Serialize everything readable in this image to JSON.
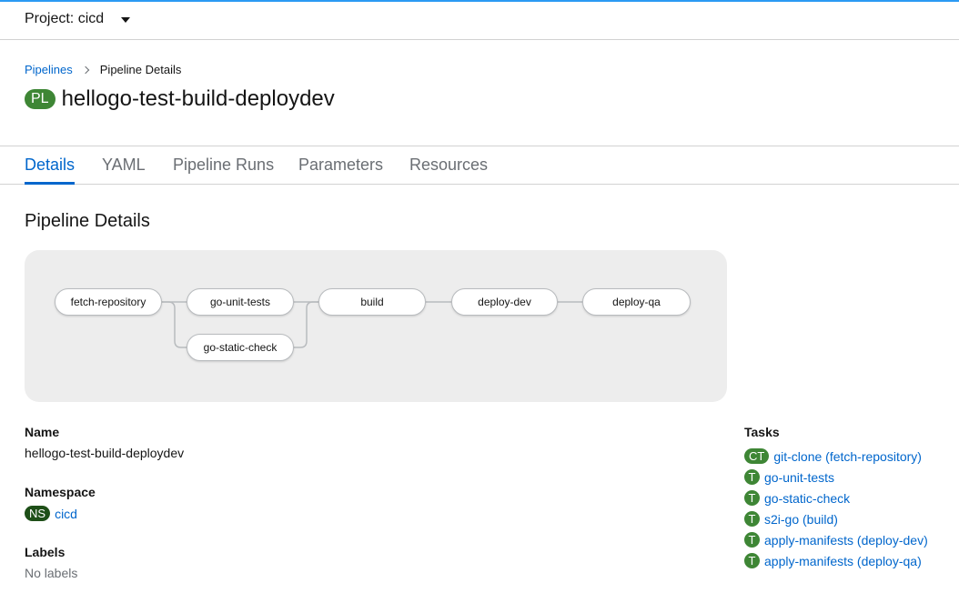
{
  "project": {
    "label": "Project: cicd"
  },
  "breadcrumb": {
    "parent": "Pipelines",
    "current": "Pipeline Details"
  },
  "header": {
    "badge": "PL",
    "title": "hellogo-test-build-deploydev"
  },
  "tabs": [
    {
      "label": "Details",
      "active": true
    },
    {
      "label": "YAML"
    },
    {
      "label": "Pipeline Runs"
    },
    {
      "label": "Parameters"
    },
    {
      "label": "Resources"
    }
  ],
  "details": {
    "section_title": "Pipeline Details",
    "name_label": "Name",
    "name_value": "hellogo-test-build-deploydev",
    "namespace_label": "Namespace",
    "namespace_badge": "NS",
    "namespace_value": "cicd",
    "labels_label": "Labels",
    "labels_value": "No labels"
  },
  "graph": {
    "nodes": [
      "fetch-repository",
      "go-unit-tests",
      "go-static-check",
      "build",
      "deploy-dev",
      "deploy-qa"
    ]
  },
  "tasks": {
    "label": "Tasks",
    "items": [
      {
        "badge": "CT",
        "label": "git-clone (fetch-repository)"
      },
      {
        "badge": "T",
        "label": "go-unit-tests"
      },
      {
        "badge": "T",
        "label": "go-static-check"
      },
      {
        "badge": "T",
        "label": "s2i-go (build)"
      },
      {
        "badge": "T",
        "label": "apply-manifests (deploy-dev)"
      },
      {
        "badge": "T",
        "label": "apply-manifests (deploy-qa)"
      }
    ]
  },
  "colors": {
    "accent": "#0066cc",
    "badge_green": "#3e8635",
    "ns_badge": "#1e4f18",
    "top_accent": "#2b9af3"
  }
}
